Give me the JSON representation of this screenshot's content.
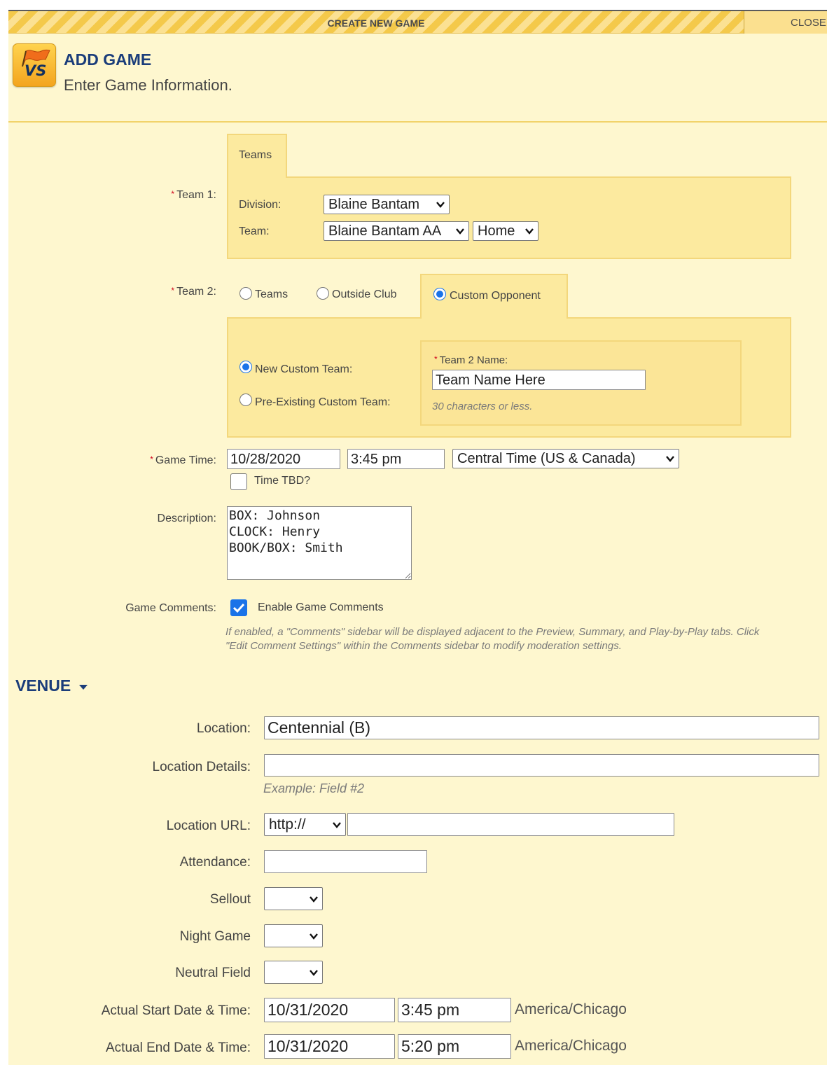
{
  "window": {
    "title": "CREATE NEW GAME",
    "close_label": "CLOSE"
  },
  "header": {
    "title": "ADD GAME",
    "subtitle": "Enter Game Information.",
    "logo_text": "VS"
  },
  "team1": {
    "label": "Team 1:",
    "tab_label": "Teams",
    "division_label": "Division:",
    "division_value": "Blaine Bantam",
    "team_label": "Team:",
    "team_value": "Blaine Bantam AA",
    "home_away_value": "Home"
  },
  "team2": {
    "label": "Team 2:",
    "options": [
      {
        "label": "Teams",
        "selected": false
      },
      {
        "label": "Outside Club",
        "selected": false
      },
      {
        "label": "Custom Opponent",
        "selected": true
      }
    ],
    "custom_choices": [
      {
        "label": "New Custom Team:",
        "selected": true
      },
      {
        "label": "Pre-Existing Custom Team:",
        "selected": false
      }
    ],
    "name_label": "Team 2 Name:",
    "name_value": "Team Name Here",
    "name_hint": "30 characters or less."
  },
  "game_time": {
    "label": "Game Time:",
    "date": "10/28/2020",
    "time": "3:45 pm",
    "timezone": "Central Time (US & Canada)",
    "tbd_label": "Time TBD?",
    "tbd_checked": false
  },
  "description": {
    "label": "Description:",
    "value": "BOX: Johnson\nCLOCK: Henry\nBOOK/BOX: Smith"
  },
  "comments": {
    "label": "Game Comments:",
    "checkbox_label": "Enable Game Comments",
    "checked": true,
    "help_line1": "If enabled, a \"Comments\" sidebar will be displayed adjacent to the Preview, Summary, and Play-by-Play tabs. Click",
    "help_line2": "\"Edit Comment Settings\" within the Comments sidebar to modify moderation settings."
  },
  "venue": {
    "title": "VENUE",
    "location_label": "Location:",
    "location_value": "Centennial (B)",
    "location_details_label": "Location Details:",
    "location_details_value": "",
    "location_details_hint": "Example: Field #2",
    "location_url_label": "Location URL:",
    "url_protocol": "http://",
    "url_value": "",
    "attendance_label": "Attendance:",
    "attendance_value": "",
    "sellout_label": "Sellout",
    "sellout_value": "",
    "night_game_label": "Night Game",
    "night_game_value": "",
    "neutral_field_label": "Neutral Field",
    "neutral_field_value": "",
    "actual_start_label": "Actual Start Date & Time:",
    "actual_start_date": "10/31/2020",
    "actual_start_time": "3:45 pm",
    "actual_start_tz": "America/Chicago",
    "actual_end_label": "Actual End Date & Time:",
    "actual_end_date": "10/31/2020",
    "actual_end_time": "5:20 pm",
    "actual_end_tz": "America/Chicago"
  },
  "colors": {
    "background": "#fef7cf",
    "fieldset": "#fcea9f",
    "accent": "#1b3d7a",
    "required": "#d0021b",
    "checkbox": "#1a73e8"
  }
}
